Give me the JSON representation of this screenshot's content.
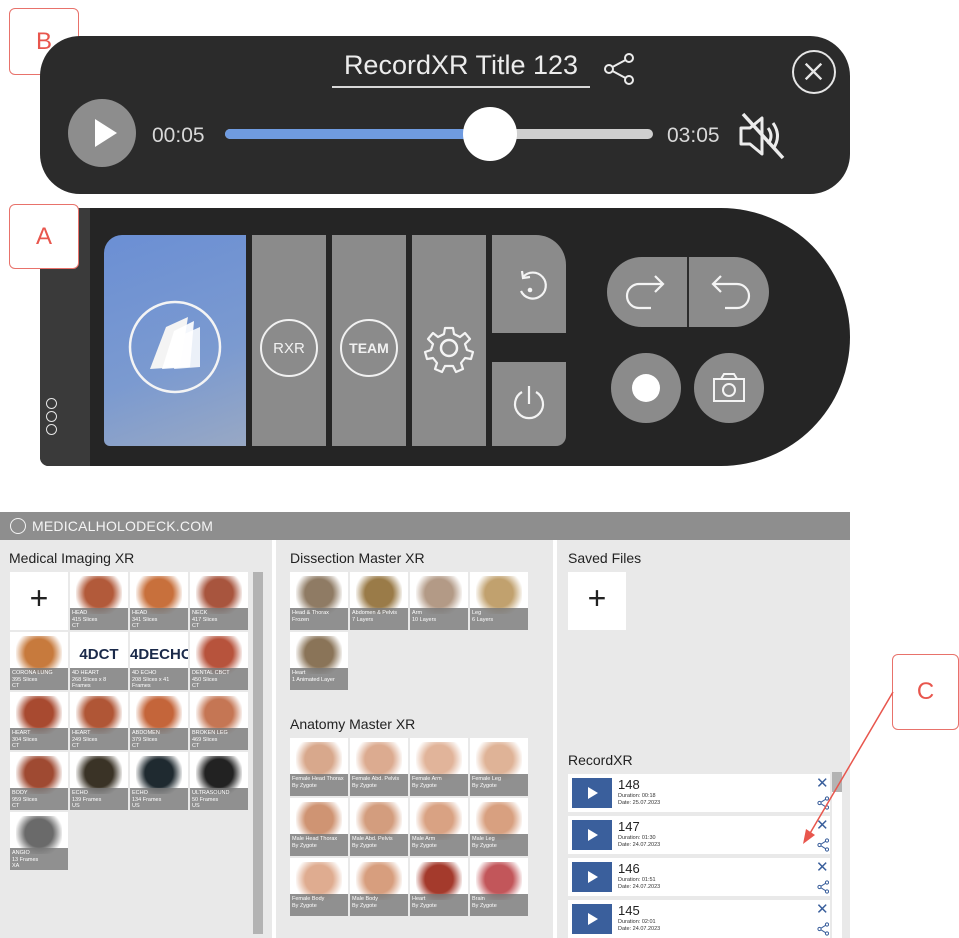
{
  "callouts": {
    "b": "B",
    "a": "A",
    "c": "C"
  },
  "player": {
    "title": "RecordXR Title 123",
    "current_time": "00:05",
    "total_time": "03:05",
    "progress": 0.62,
    "icons": {
      "share": "share-icon",
      "close": "close-circle-icon",
      "play": "play-icon",
      "mute": "speaker-muted-icon"
    }
  },
  "control_bar": {
    "tiles": [
      {
        "label": "",
        "icon": "library-books-icon"
      },
      {
        "label": "RXR"
      },
      {
        "label": "TEAM"
      },
      {
        "label": "",
        "icon": "gear-icon"
      }
    ],
    "small_tiles": [
      {
        "icon": "reset-icon"
      },
      {
        "icon": "power-icon"
      }
    ],
    "pill": [
      {
        "icon": "redo-icon"
      },
      {
        "icon": "undo-icon"
      }
    ],
    "round_buttons": [
      {
        "icon": "record-icon"
      },
      {
        "icon": "camera-icon"
      }
    ],
    "colors": {
      "active_tile": "#6b8fd4",
      "tile": "#8b8b8b",
      "bar": "#252525"
    }
  },
  "app": {
    "header": "MEDICALHOLODECK.COM",
    "medical_imaging": {
      "title": "Medical Imaging XR",
      "items": [
        {
          "name": "HEAD",
          "detail": "415 Slices\nCT\nAnonymized",
          "color": "#b25a3a"
        },
        {
          "name": "HEAD",
          "detail": "341 Slices\nCT\nAnonymized",
          "color": "#c8703c"
        },
        {
          "name": "NECK",
          "detail": "417 Slices\nCT\nAnonymized",
          "color": "#a8553e"
        },
        {
          "name": "CORONA LUNG",
          "detail": "395 Slices\nCT\nAnonymized",
          "color": "#c77a3d"
        },
        {
          "name": "4D HEART",
          "detail": "268 Slices x 8 Frames\nCT\nAnonymized",
          "logo": "4DCT"
        },
        {
          "name": "4D ECHO",
          "detail": "208 Slices x 41 Frames\nUS\nAnonymized",
          "logo": "4DECHO"
        },
        {
          "name": "DENTAL CBCT",
          "detail": "450 Slices\nCT\nAnonymized",
          "color": "#b7533c"
        },
        {
          "name": "HEART",
          "detail": "304 Slices\nCT\nAnonymized",
          "color": "#a84a30"
        },
        {
          "name": "HEART",
          "detail": "249 Slices\nCT\nAnonymized",
          "color": "#b05636"
        },
        {
          "name": "ABDOMEN",
          "detail": "379 Slices\nCT\nAnonymized",
          "color": "#c4653a"
        },
        {
          "name": "BROKEN LEG",
          "detail": "469 Slices\nCT\nAnonymized",
          "color": "#c57654"
        },
        {
          "name": "BODY",
          "detail": "959 Slices\nCT\nAnonymized",
          "color": "#9f4a32"
        },
        {
          "name": "ECHO",
          "detail": "139 Frames\nUS\nAnonymized",
          "color": "#3a3326"
        },
        {
          "name": "ECHO",
          "detail": "134 Frames\nUS\nAnonymized",
          "color": "#1f2a30"
        },
        {
          "name": "ULTRASOUND",
          "detail": "50 Frames\nUS\nAnonymized",
          "color": "#222222"
        },
        {
          "name": "ANGIO",
          "detail": "13 Frames\nXA\nAnonymized",
          "color": "#6a6a6a"
        }
      ]
    },
    "dissection": {
      "title": "Dissection Master XR",
      "items": [
        {
          "name": "Head & Thorax",
          "detail": "Frozen",
          "color": "#8f7b64"
        },
        {
          "name": "Abdomen & Pelvis",
          "detail": "7 Layers",
          "color": "#9a7b48"
        },
        {
          "name": "Arm",
          "detail": "10 Layers",
          "color": "#b39a86"
        },
        {
          "name": "Leg",
          "detail": "6 Layers",
          "color": "#c1a16e"
        },
        {
          "name": "Heart",
          "detail": "1 Animated Layer",
          "color": "#8a7458"
        }
      ]
    },
    "anatomy": {
      "title": "Anatomy Master XR",
      "items": [
        {
          "name": "Female Head Thorax",
          "detail": "By Zygote",
          "color": "#d8a88c"
        },
        {
          "name": "Female Abd. Pelvis",
          "detail": "By Zygote",
          "color": "#dcab90"
        },
        {
          "name": "Female Arm",
          "detail": "By Zygote",
          "color": "#e1b49a"
        },
        {
          "name": "Female Leg",
          "detail": "By Zygote",
          "color": "#dfb397"
        },
        {
          "name": "Male Head Thorax",
          "detail": "By Zygote",
          "color": "#cf9473"
        },
        {
          "name": "Male Abd. Pelvis",
          "detail": "By Zygote",
          "color": "#d39d7e"
        },
        {
          "name": "Male Arm",
          "detail": "By Zygote",
          "color": "#d9a283"
        },
        {
          "name": "Male Leg",
          "detail": "By Zygote",
          "color": "#d8a080"
        },
        {
          "name": "Female Body",
          "detail": "By Zygote",
          "color": "#dfac90"
        },
        {
          "name": "Male Body",
          "detail": "By Zygote",
          "color": "#d79e7e"
        },
        {
          "name": "Heart",
          "detail": "By Zygote",
          "color": "#a43a2c"
        },
        {
          "name": "Brain",
          "detail": "By Zygote",
          "color": "#c2565a"
        }
      ]
    },
    "saved_files": {
      "title": "Saved Files"
    },
    "recordxr": {
      "title": "RecordXR",
      "items": [
        {
          "number": "148",
          "duration": "Duration: 00:18",
          "date": "Date: 25.07.2023"
        },
        {
          "number": "147",
          "duration": "Duration: 01:30",
          "date": "Date: 24.07.2023"
        },
        {
          "number": "146",
          "duration": "Duration: 01:51",
          "date": "Date: 24.07.2023"
        },
        {
          "number": "145",
          "duration": "Duration: 02:01",
          "date": "Date: 24.07.2023"
        }
      ]
    }
  }
}
